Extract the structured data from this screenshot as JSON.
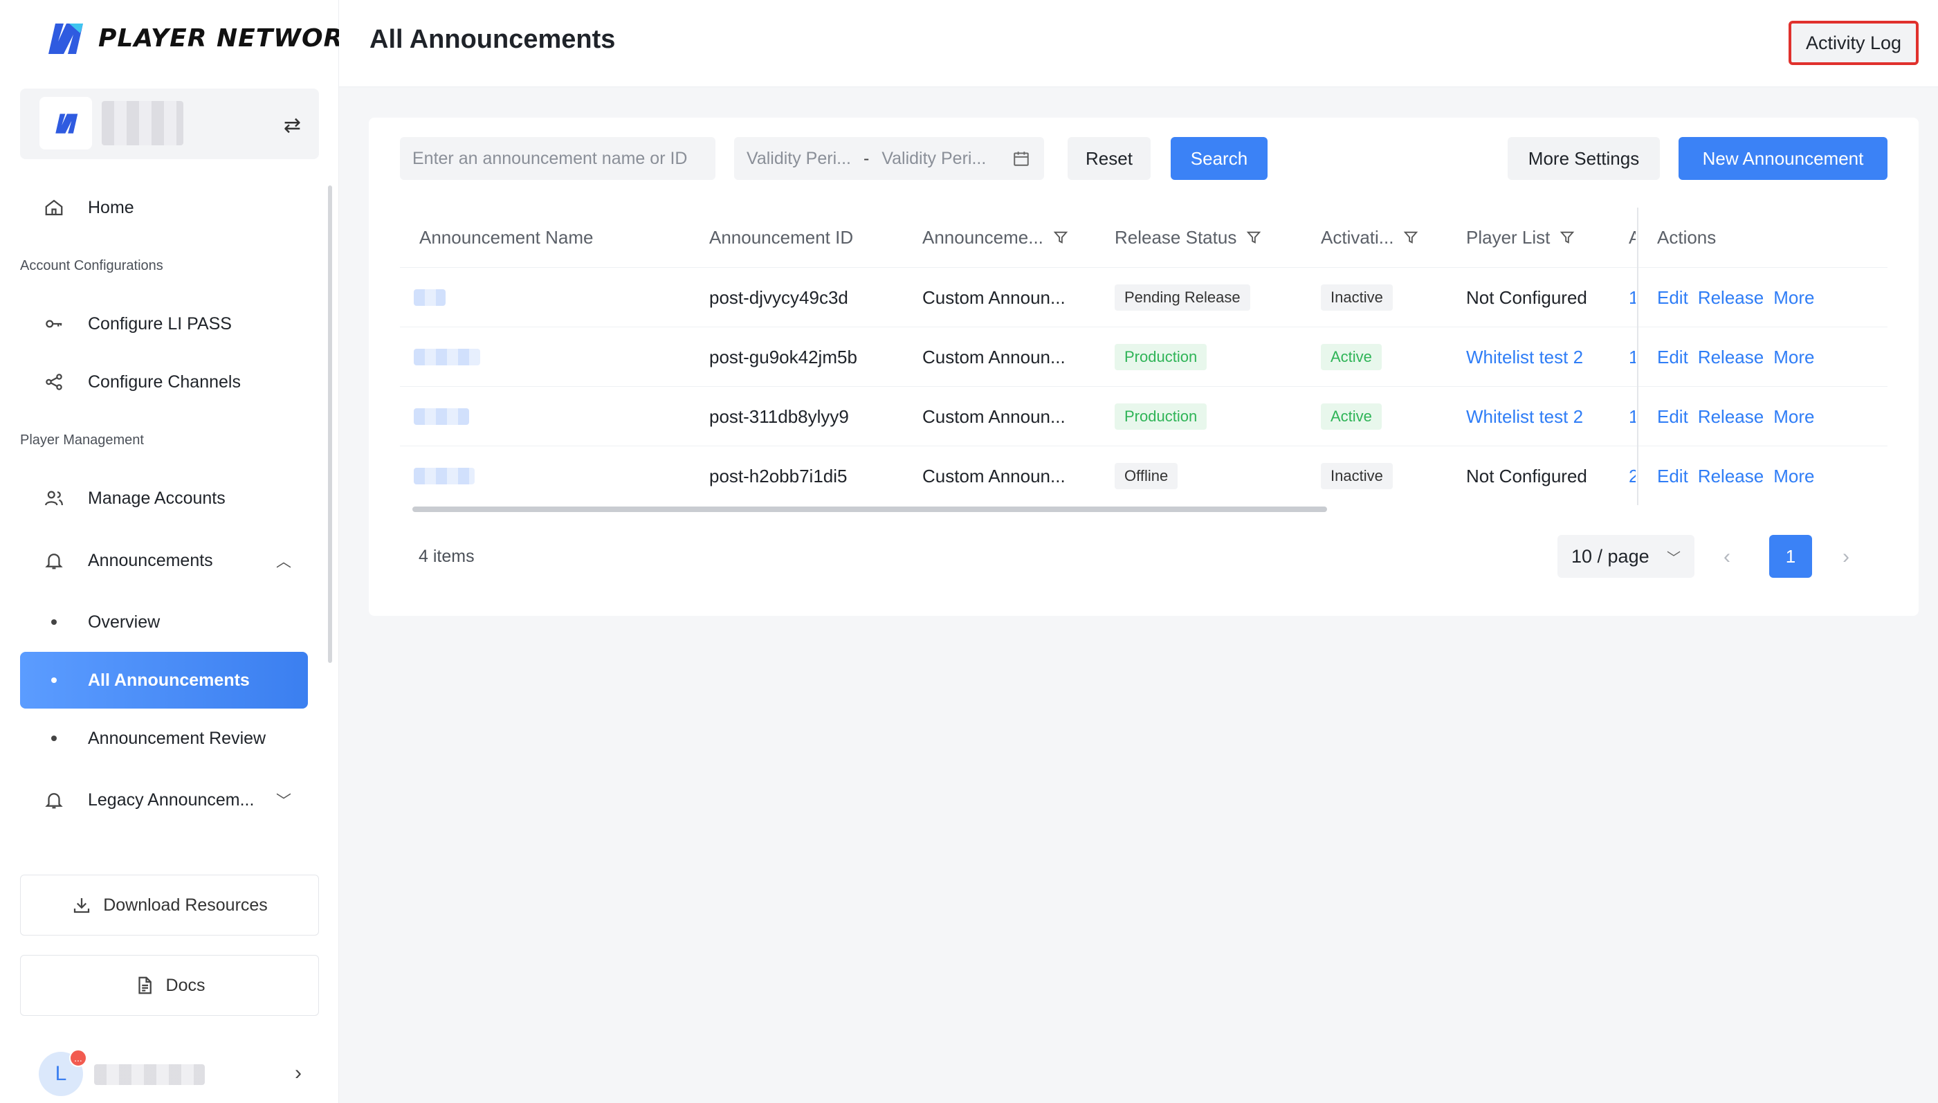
{
  "brand": {
    "name": "PLAYER NETWORK"
  },
  "sidebar": {
    "home": "Home",
    "section_account": "Account Configurations",
    "configure_li_pass": "Configure LI PASS",
    "configure_channels": "Configure Channels",
    "section_player": "Player Management",
    "manage_accounts": "Manage Accounts",
    "announcements": "Announcements",
    "overview": "Overview",
    "all_announcements": "All Announcements",
    "announcement_review": "Announcement Review",
    "legacy_announcements": "Legacy Announcem...",
    "download_resources": "Download Resources",
    "docs": "Docs",
    "user_initial": "L",
    "user_badge": "..."
  },
  "header": {
    "title": "All Announcements",
    "activity_log": "Activity Log"
  },
  "toolbar": {
    "search_placeholder": "Enter an announcement name or ID",
    "validity_start": "Validity Peri...",
    "validity_sep": "-",
    "validity_end": "Validity Peri...",
    "reset": "Reset",
    "search": "Search",
    "more_settings": "More Settings",
    "new_announcement": "New Announcement"
  },
  "table": {
    "columns": {
      "name": "Announcement Name",
      "id": "Announcement ID",
      "type": "Announceme...",
      "release_status": "Release Status",
      "activation": "Activati...",
      "player_list": "Player List",
      "extra": "A",
      "actions": "Actions"
    },
    "rows": [
      {
        "id": "post-djvycy49c3d",
        "type": "Custom Announ...",
        "release_status": "Pending Release",
        "release_color": "gray",
        "activation": "Inactive",
        "activation_color": "gray",
        "player_list": "Not Configured",
        "player_link": false,
        "extra": "1"
      },
      {
        "id": "post-gu9ok42jm5b",
        "type": "Custom Announ...",
        "release_status": "Production",
        "release_color": "green",
        "activation": "Active",
        "activation_color": "green",
        "player_list": "Whitelist test 2",
        "player_link": true,
        "extra": "1"
      },
      {
        "id": "post-311db8ylyy9",
        "type": "Custom Announ...",
        "release_status": "Production",
        "release_color": "green",
        "activation": "Active",
        "activation_color": "green",
        "player_list": "Whitelist test 2",
        "player_link": true,
        "extra": "1"
      },
      {
        "id": "post-h2obb7i1di5",
        "type": "Custom Announ...",
        "release_status": "Offline",
        "release_color": "gray",
        "activation": "Inactive",
        "activation_color": "gray",
        "player_list": "Not Configured",
        "player_link": false,
        "extra": "2"
      }
    ],
    "action_labels": {
      "edit": "Edit",
      "release": "Release",
      "more": "More"
    }
  },
  "pagination": {
    "total": "4 items",
    "page_size": "10 / page",
    "current_page": "1"
  },
  "colors": {
    "accent": "#3b82f6",
    "success": "#2fb457",
    "highlight_border": "#e0312d"
  }
}
